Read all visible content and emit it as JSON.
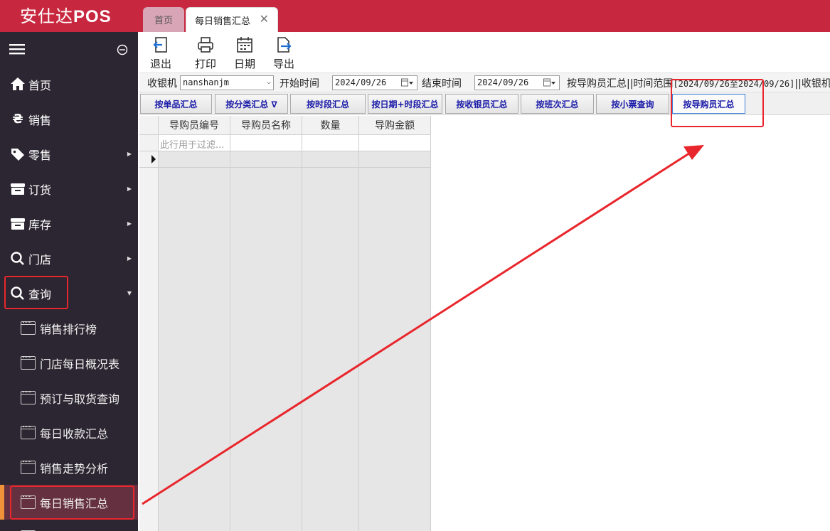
{
  "app": {
    "brand_prefix": "安仕达",
    "brand_suffix": "POS",
    "accent": "#c8283f"
  },
  "tabs": [
    {
      "label": "首页"
    },
    {
      "label": "每日销售汇总",
      "close": "✕"
    }
  ],
  "sidebar": {
    "items": [
      {
        "label": "首页",
        "icon": "home-icon"
      },
      {
        "label": "销售",
        "icon": "currency-icon"
      },
      {
        "label": "零售",
        "icon": "tag-icon"
      },
      {
        "label": "订货",
        "icon": "store-icon"
      },
      {
        "label": "库存",
        "icon": "store-icon"
      },
      {
        "label": "门店",
        "icon": "search-icon"
      },
      {
        "label": "查询",
        "icon": "search-icon"
      }
    ],
    "sub_items": [
      {
        "label": "销售排行榜"
      },
      {
        "label": "门店每日概况表"
      },
      {
        "label": "预订与取货查询"
      },
      {
        "label": "每日收款汇总"
      },
      {
        "label": "销售走势分析"
      },
      {
        "label": "每日销售汇总"
      }
    ]
  },
  "toolbar": {
    "exit": "退出",
    "print": "打印",
    "date": "日期",
    "export": "导出"
  },
  "filter": {
    "cashier_label": "收银机",
    "cashier_value": "nanshanjm",
    "start_label": "开始时间",
    "start_value": "2024/09/26",
    "end_label": "结束时间",
    "end_value": "2024/09/26",
    "info_prefix": "按导购员汇总||时间范围",
    "info_range": "[2024/09/26至2024/09/26]",
    "info_suffix": "||收银机"
  },
  "buttons": [
    "按单品汇总",
    "按分类汇总 ∇",
    "按时段汇总",
    "按日期+时段汇总",
    "按收银员汇总",
    "按班次汇总",
    "按小票查询",
    "按导购员汇总"
  ],
  "grid": {
    "columns": [
      "导购员编号",
      "导购员名称",
      "数量",
      "导购金额"
    ],
    "filter_placeholder": "此行用于过滤..."
  },
  "colors": {
    "annotation": "#e8262c",
    "sidebar_bg": "#2b2631",
    "active_bar": "#f0923a"
  }
}
